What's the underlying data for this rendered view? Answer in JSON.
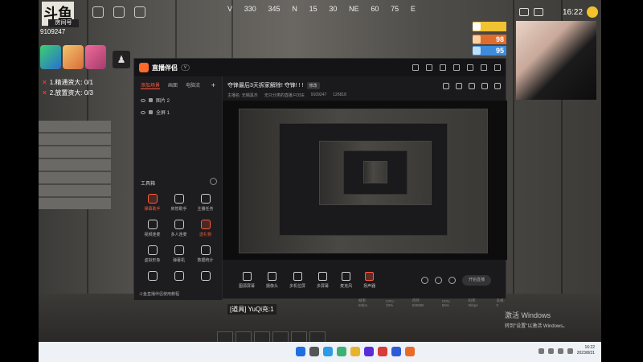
{
  "hud": {
    "logo_text": "斗鱼",
    "room_label": "房间号",
    "room_id": "9109247",
    "compass": [
      "V",
      "330",
      "345",
      "N",
      "15",
      "30",
      "NE",
      "60",
      "75",
      "E"
    ],
    "tasks": [
      "1.精通资大: 0/1",
      "2.放置资大: 0/3"
    ],
    "clock": "16:22",
    "stats": [
      {
        "value": "",
        "color": "#f1c232"
      },
      {
        "value": "98",
        "color": "#e06c2c"
      },
      {
        "value": "95",
        "color": "#3d8bd9"
      }
    ],
    "chat": "[道具] YuQi充:1",
    "activate_title": "激活 Windows",
    "activate_sub": "转到\"设置\"以激活 Windows。"
  },
  "app": {
    "title": "直播伴侣",
    "version": "v",
    "left_tabs": [
      "添加场景",
      "画面",
      "电脑流"
    ],
    "scenes": [
      "图片 2",
      "全屏 1"
    ],
    "toolbox_title": "工具箱",
    "tools": [
      {
        "label": "弹幕助手",
        "hot": true
      },
      {
        "label": "房管助手",
        "hot": false
      },
      {
        "label": "主播任务",
        "hot": false
      },
      {
        "label": "视频连麦",
        "hot": false
      },
      {
        "label": "多人连麦",
        "hot": false
      },
      {
        "label": "送礼物",
        "hot": true
      },
      {
        "label": "虚拟形象",
        "hot": false
      },
      {
        "label": "弹幕机",
        "hot": false
      },
      {
        "label": "数据统计",
        "hot": false
      },
      {
        "label": "",
        "hot": false
      },
      {
        "label": "",
        "hot": false
      },
      {
        "label": "",
        "hot": false
      }
    ],
    "left_footer": "斗鱼直播伴侣使用教程",
    "stream_title": "夺锋最后3天拆家解除! 夺锋! ! !",
    "stream_badge": "修改",
    "stream_meta": [
      "主播名: 无锡黑杰",
      "无只分类的直播 FOSE",
      "9109247",
      "126818"
    ],
    "bottom_tools": [
      "图源屏幕",
      "摄像头",
      "多机位屏",
      "多屏幕",
      "麦克风",
      "扬声器"
    ],
    "start_label": "开始直播",
    "status": [
      "帧率: 60fps",
      "CPU: 32%",
      "内存: 600MB",
      "CPU: 55%",
      "码率: 0kbps",
      "丢帧: 0"
    ]
  },
  "taskbar": {
    "time": "16:22",
    "date": "2023/8/31"
  }
}
